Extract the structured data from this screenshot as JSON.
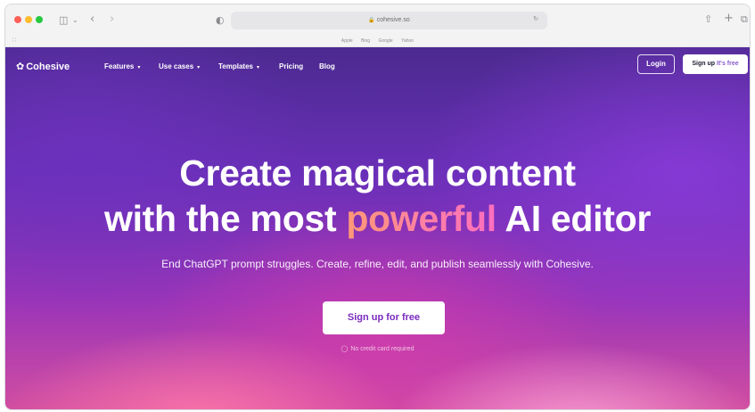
{
  "browser": {
    "url": "cohesive.so",
    "favorites": [
      "Apple",
      "Bing",
      "Google",
      "Yahoo"
    ],
    "icons": {
      "sidebar": "sidebar-icon",
      "back": "chevron-left-icon",
      "forward": "chevron-right-icon",
      "privacy": "shield-icon",
      "lock": "lock-icon",
      "share": "share-icon",
      "new_tab": "plus-icon",
      "tabs": "tab-overview-icon"
    }
  },
  "nav": {
    "brand": "Cohesive",
    "items": [
      {
        "label": "Features",
        "has_dropdown": true
      },
      {
        "label": "Use cases",
        "has_dropdown": true
      },
      {
        "label": "Templates",
        "has_dropdown": true
      },
      {
        "label": "Pricing",
        "has_dropdown": false
      },
      {
        "label": "Blog",
        "has_dropdown": false
      }
    ],
    "login": "Login",
    "signup_main": "Sign up",
    "signup_sub": "It's free"
  },
  "hero": {
    "line1": "Create magical content",
    "line2_pre": "with the most ",
    "line2_accent": "powerful",
    "line2_post": " AI editor",
    "subtitle": "End ChatGPT prompt struggles. Create, refine, edit, and publish seamlessly with Cohesive.",
    "cta": "Sign up for free",
    "note": "No credit card required"
  },
  "colors": {
    "accent_gradient_start": "#ff9a76",
    "accent_gradient_end": "#ff6fbf",
    "cta_text": "#7a2bbf",
    "background_top": "#4b2a8f",
    "background_bottom": "#d24ea0"
  }
}
